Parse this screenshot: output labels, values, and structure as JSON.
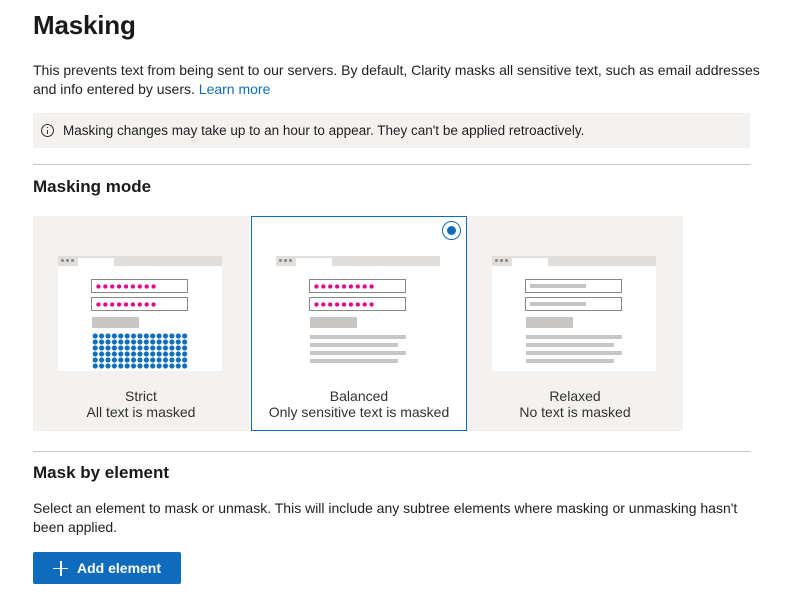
{
  "page": {
    "title": "Masking",
    "description": "This prevents text from being sent to our servers. By default, Clarity masks all sensitive text, such as email addresses and info entered by users.",
    "learn_more": "Learn more",
    "notice": "Masking changes may take up to an hour to appear. They can't be applied retroactively.",
    "notice_icon": "info-icon"
  },
  "masking_mode": {
    "heading": "Masking mode",
    "selected": "Balanced",
    "options": [
      {
        "name": "Strict",
        "caption": "All text is masked",
        "selected": false
      },
      {
        "name": "Balanced",
        "caption": "Only sensitive text is masked",
        "selected": true
      },
      {
        "name": "Relaxed",
        "caption": "No text is masked",
        "selected": false
      }
    ]
  },
  "mask_by_element": {
    "heading": "Mask by element",
    "description": "Select an element to mask or unmask. This will include any subtree elements where masking or unmasking hasn't been applied.",
    "add_button": "Add element",
    "add_icon": "plus-icon"
  },
  "colors": {
    "accent": "#0f6cbd",
    "mask_pink": "#e3008c",
    "mask_blue": "#106ebe",
    "card_bg": "#f3f2f1"
  }
}
